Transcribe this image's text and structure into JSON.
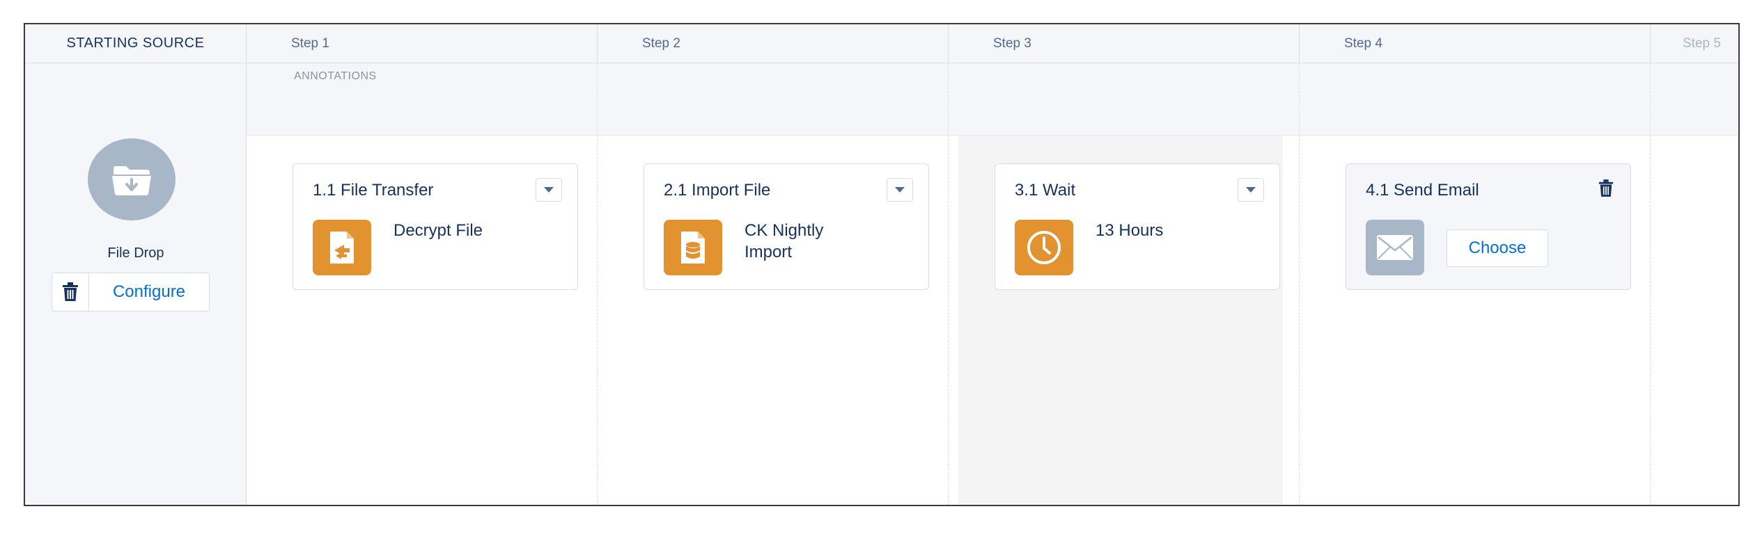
{
  "header": {
    "source_label": "STARTING SOURCE",
    "steps": [
      "Step 1",
      "Step 2",
      "Step 3",
      "Step 4",
      "Step 5"
    ]
  },
  "annotations_label": "ANNOTATIONS",
  "source": {
    "name": "File Drop",
    "icon": "folder-download-icon",
    "configure_label": "Configure"
  },
  "activities": [
    {
      "title": "1.1 File Transfer",
      "label": "Decrypt File",
      "icon": "file-transfer-icon",
      "action": "dropdown"
    },
    {
      "title": "2.1 Import File",
      "label_lines": [
        "CK Nightly",
        "Import"
      ],
      "icon": "database-file-icon",
      "action": "dropdown"
    },
    {
      "title": "3.1 Wait",
      "label": "13 Hours",
      "icon": "clock-icon",
      "action": "dropdown"
    },
    {
      "title": "4.1 Send Email",
      "button": "Choose",
      "icon": "envelope-icon",
      "action": "delete"
    }
  ],
  "colors": {
    "accent_orange": "#e2922e",
    "link_blue": "#0070d2",
    "text_navy": "#16325c",
    "muted_gray": "#a8b7c7",
    "panel_bg": "#f4f6f9"
  }
}
